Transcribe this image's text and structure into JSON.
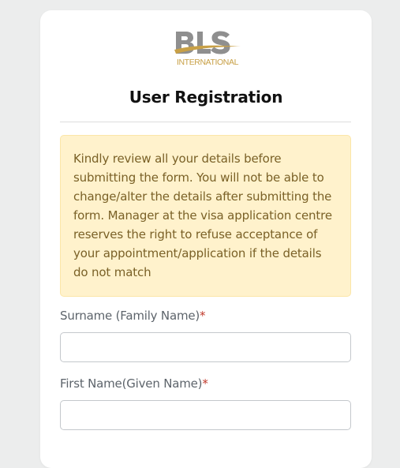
{
  "logo": {
    "letters": "BLS",
    "subtext": "INTERNATIONAL",
    "colors": {
      "grey": "#8f8f8f",
      "gold": "#c8a046"
    }
  },
  "form": {
    "title": "User Registration",
    "notice": "Kindly review all your details before submitting the form. You will not be able to change/alter the details after submitting the form. Manager at the visa application centre reserves the right to refuse acceptance of your appointment/application if the details do not match",
    "fields": {
      "surname": {
        "label": "Surname (Family Name)",
        "required_mark": "*",
        "value": "",
        "placeholder": ""
      },
      "first_name": {
        "label": "First Name(Given Name)",
        "required_mark": "*",
        "value": "",
        "placeholder": ""
      }
    }
  },
  "colors": {
    "page_bg": "#eceded",
    "notice_bg": "#fff2cc",
    "notice_text": "#7a6127",
    "required": "#c0392b"
  }
}
